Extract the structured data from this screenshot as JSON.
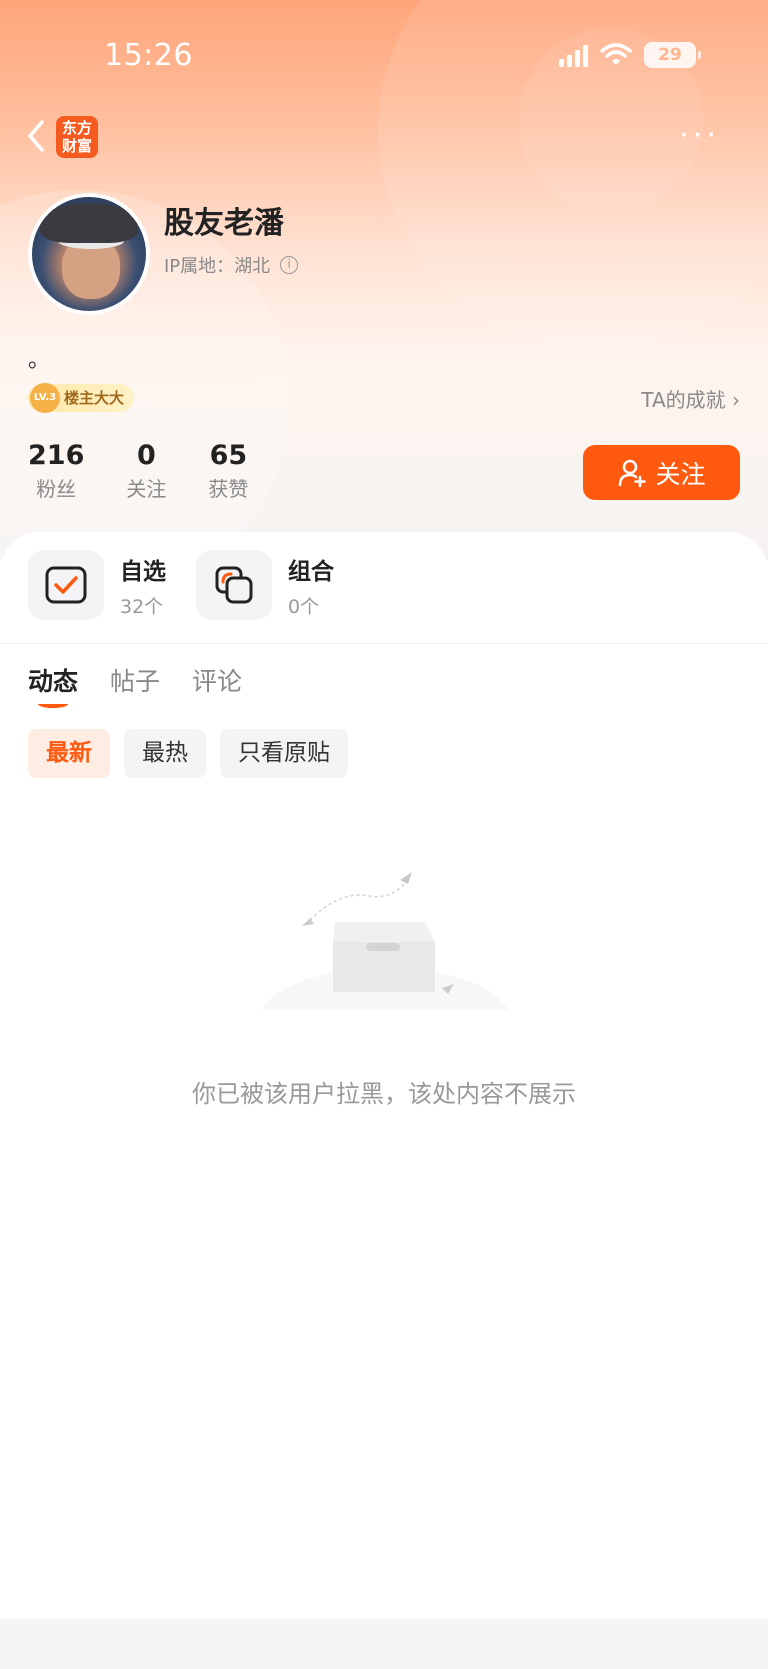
{
  "status_bar": {
    "time": "15:26",
    "battery": "29"
  },
  "header": {
    "logo_line1": "东方",
    "logo_line2": "财富",
    "more": "···"
  },
  "profile": {
    "name": "股友老潘",
    "ip_label": "IP属地：湖北",
    "bio": "。",
    "badge_level": "LV.3",
    "badge_label": "楼主大大",
    "achievement_link": "TA的成就 ›"
  },
  "stats": [
    {
      "value": "216",
      "label": "粉丝"
    },
    {
      "value": "0",
      "label": "关注"
    },
    {
      "value": "65",
      "label": "获赞"
    }
  ],
  "follow_button": "关注",
  "tools": [
    {
      "title": "自选",
      "sub": "32个"
    },
    {
      "title": "组合",
      "sub": "0个"
    }
  ],
  "tabs": [
    "动态",
    "帖子",
    "评论"
  ],
  "filters": [
    "最新",
    "最热",
    "只看原贴"
  ],
  "empty_message": "你已被该用户拉黑，该处内容不展示",
  "colors": {
    "accent": "#ff5a10",
    "brand": "#f55a1e"
  }
}
